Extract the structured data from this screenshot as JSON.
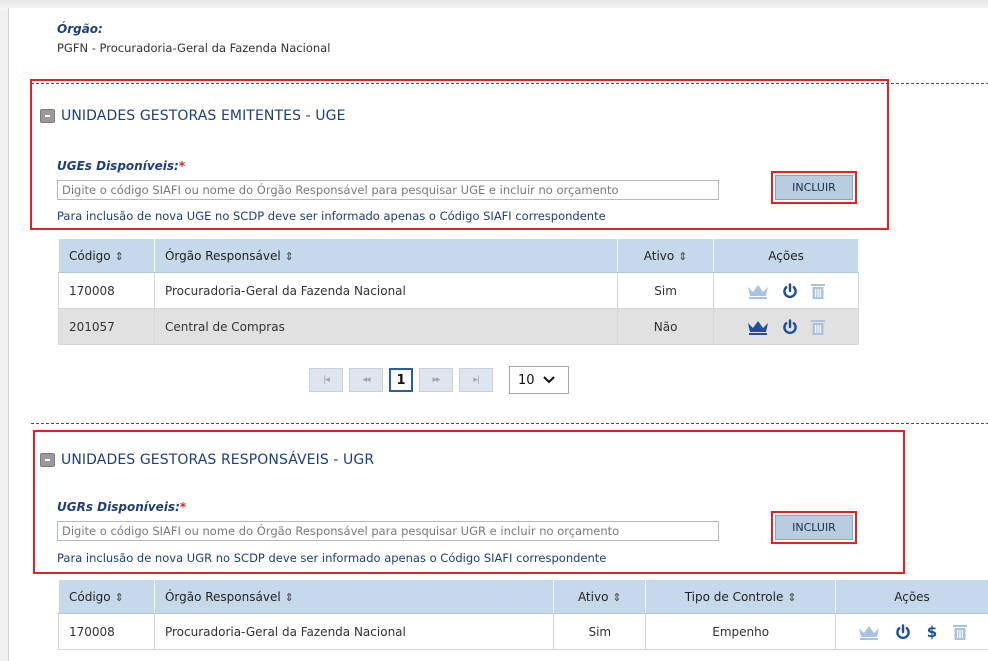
{
  "orgao": {
    "label": "Órgão:",
    "value": "PGFN - Procuradoria-Geral da Fazenda Nacional"
  },
  "uge": {
    "title": "UNIDADES GESTORAS EMITENTES - UGE",
    "field_label": "UGEs Disponíveis:",
    "required_mark": "*",
    "placeholder": "Digite o código SIAFI ou nome do Órgão Responsável para pesquisar UGE e incluir no orçamento",
    "button": "INCLUIR",
    "hint": "Para inclusão de nova UGE no SCDP deve ser informado apenas o Código SIAFI correspondente",
    "columns": [
      "Código",
      "Órgão Responsável",
      "Ativo",
      "Ações"
    ],
    "rows": [
      {
        "codigo": "170008",
        "orgao": "Procuradoria-Geral da Fazenda Nacional",
        "ativo": "Sim",
        "crown_active": false
      },
      {
        "codigo": "201057",
        "orgao": "Central de Compras",
        "ativo": "Não",
        "crown_active": true
      }
    ],
    "pagination": {
      "first": "|◂",
      "prev": "◂◂",
      "current": "1",
      "next": "▸▸",
      "last": "▸|",
      "page_size": "10"
    }
  },
  "ugr": {
    "title": "UNIDADES GESTORAS RESPONSÁVEIS - UGR",
    "field_label": "UGRs Disponíveis:",
    "required_mark": "*",
    "placeholder": "Digite o código SIAFI ou nome do Órgão Responsável para pesquisar UGR e incluir no orçamento",
    "button": "INCLUIR",
    "hint": "Para inclusão de nova UGR no SCDP deve ser informado apenas o Código SIAFI correspondente",
    "columns": [
      "Código",
      "Órgão Responsável",
      "Ativo",
      "Tipo de Controle",
      "Ações"
    ],
    "rows": [
      {
        "codigo": "170008",
        "orgao": "Procuradoria-Geral da Fazenda Nacional",
        "ativo": "Sim",
        "tipo": "Empenho"
      }
    ]
  },
  "colors": {
    "accent": "#1f3f78",
    "icon_blue": "#1e4f9c",
    "icon_light": "#a9c4e2",
    "highlight_red": "#e02424"
  }
}
